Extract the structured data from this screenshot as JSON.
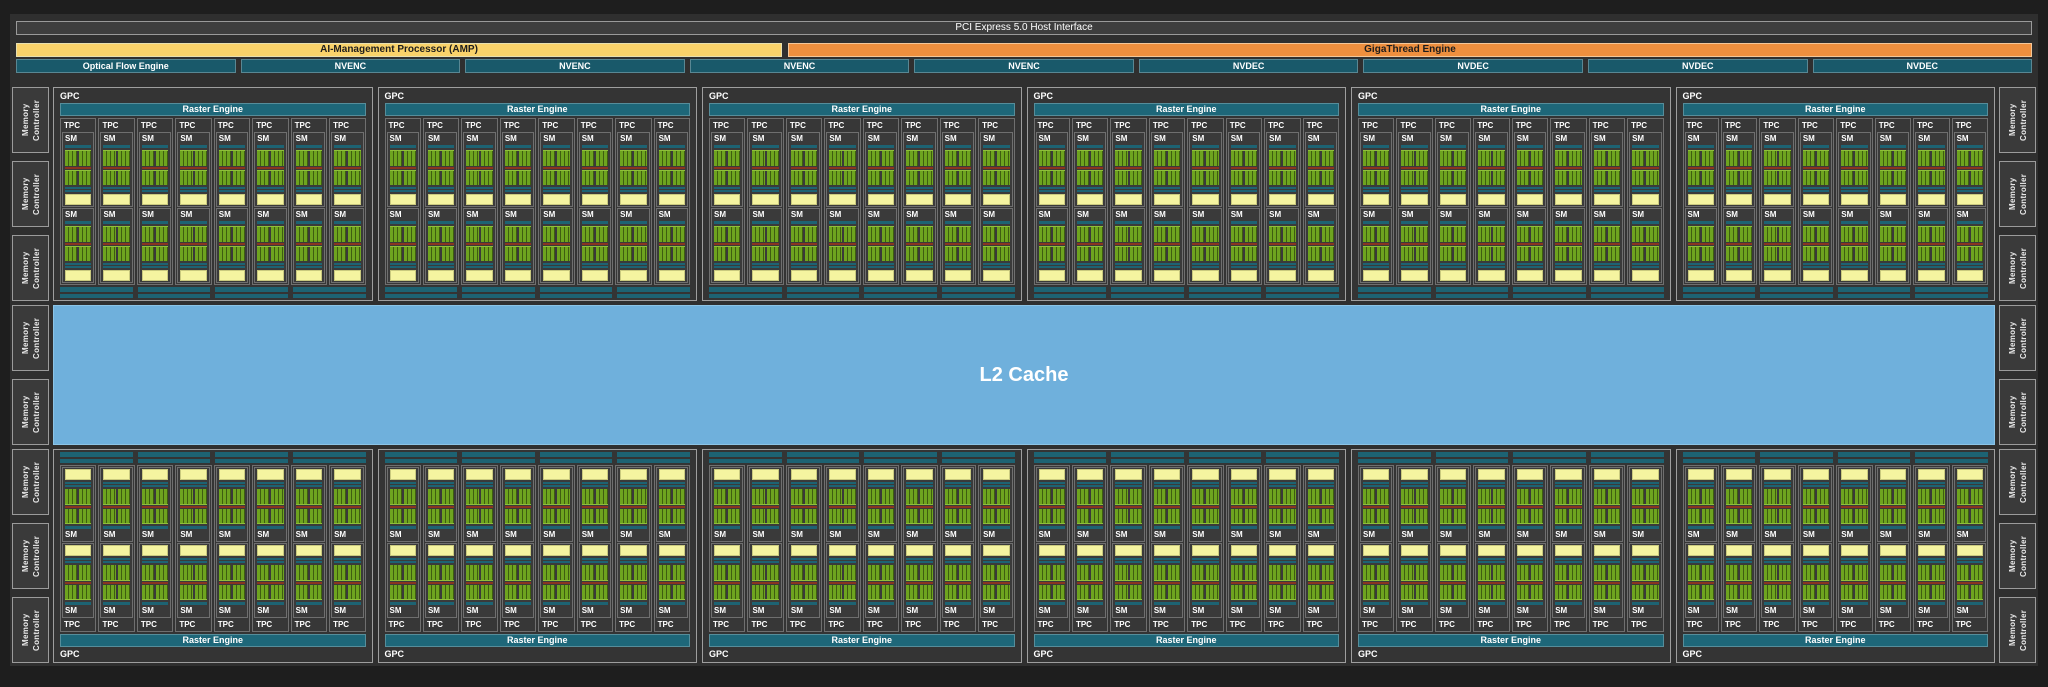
{
  "diagram": {
    "top_bars": {
      "pcie_label": "PCI Express 5.0 Host Interface",
      "amp_label": "AI-Management Processor (AMP)",
      "gigathread_label": "GigaThread Engine"
    },
    "engine_row": [
      "Optical Flow Engine",
      "NVENC",
      "NVENC",
      "NVENC",
      "NVENC",
      "NVDEC",
      "NVDEC",
      "NVDEC",
      "NVDEC"
    ],
    "l2_cache": {
      "label": "L2 Cache"
    },
    "memory_controller": {
      "label": "Memory Controller",
      "left_count": 8,
      "right_count": 8,
      "per_side_zones": [
        3,
        2,
        3
      ]
    },
    "gpc": {
      "label": "GPC",
      "raster_label": "Raster Engine",
      "tpc_label": "TPC",
      "sm_label": "SM",
      "top_row_count": 6,
      "bottom_row_count": 6,
      "tpc_per_gpc": 8,
      "sm_per_tpc": 2,
      "geometry_segments_per_row": 4
    },
    "colors": {
      "pcie_bg": "#3e3e3e",
      "amp_bg": "#f9d26a",
      "gigathread_bg": "#ee8f3e",
      "engine_teal": "#19596a",
      "raster_teal": "#1e6779",
      "strip_teal": "#1d6373",
      "sm_bg": "#3a3a3a",
      "green": "#6ea41f",
      "green_dark": "#3e5d10",
      "red_sep": "#8a3420",
      "yellow": "#f5f4a0",
      "l2_blue": "#6fb0dc"
    }
  }
}
